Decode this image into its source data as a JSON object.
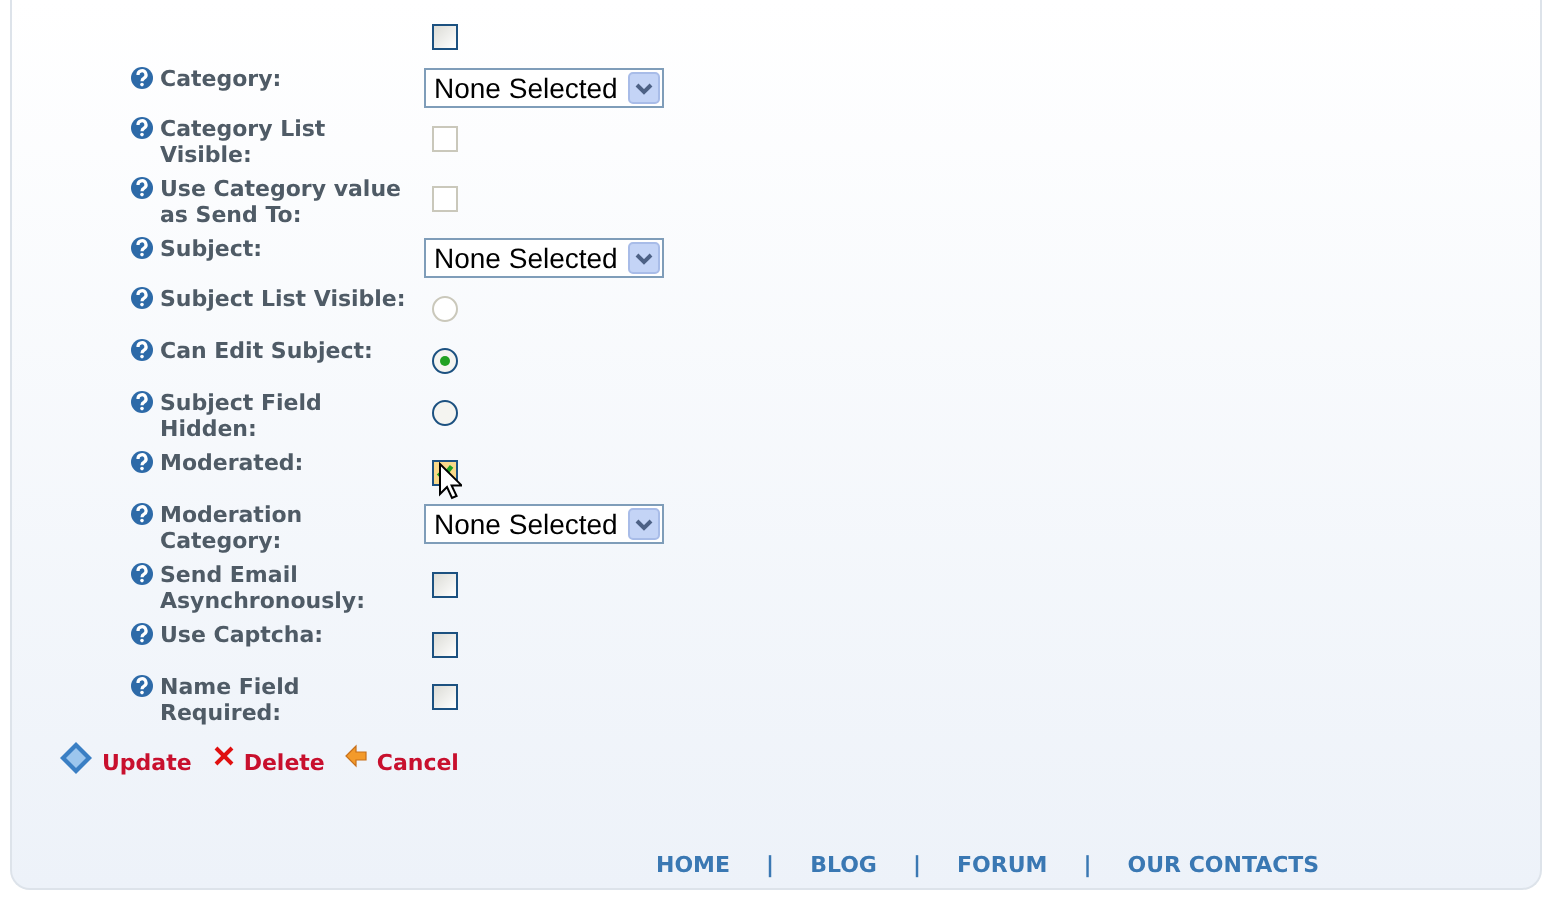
{
  "fields": [
    {
      "kind": "checkbox",
      "checked": false,
      "disabled": false
    },
    {
      "kind": "select",
      "label": "Category:",
      "value": "None Selected"
    },
    {
      "kind": "checkbox",
      "label": "Category List Visible:",
      "checked": false,
      "disabled": true
    },
    {
      "kind": "checkbox",
      "label": "Use Category value as Send To:",
      "checked": false,
      "disabled": true
    },
    {
      "kind": "select",
      "label": "Subject:",
      "value": "None Selected"
    },
    {
      "kind": "radio",
      "label": "Subject List Visible:",
      "selected": false,
      "disabled": true
    },
    {
      "kind": "radio",
      "label": "Can Edit Subject:",
      "selected": true,
      "disabled": false
    },
    {
      "kind": "radio",
      "label": "Subject Field Hidden:",
      "selected": false,
      "disabled": false
    },
    {
      "kind": "checkbox",
      "label": "Moderated:",
      "checked": true,
      "disabled": false,
      "cursor": true
    },
    {
      "kind": "select",
      "label": "Moderation Category:",
      "value": "None Selected"
    },
    {
      "kind": "checkbox",
      "label": "Send Email Asynchronously:",
      "checked": false,
      "disabled": false
    },
    {
      "kind": "checkbox",
      "label": "Use Captcha:",
      "checked": false,
      "disabled": false
    },
    {
      "kind": "checkbox",
      "label": "Name Field Required:",
      "checked": false,
      "disabled": false
    }
  ],
  "actions": [
    {
      "kind": "update",
      "label": "Update"
    },
    {
      "kind": "delete",
      "label": "Delete"
    },
    {
      "kind": "cancel",
      "label": "Cancel"
    }
  ],
  "footer_links": [
    "HOME",
    "BLOG",
    "FORUM",
    "OUR CONTACTS"
  ],
  "footer_separator": "|"
}
